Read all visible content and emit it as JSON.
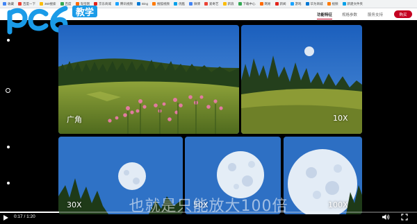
{
  "bookmarks": [
    {
      "label": "收藏"
    },
    {
      "label": "百度一下"
    },
    {
      "label": "360搜索"
    },
    {
      "label": "百度"
    },
    {
      "label": "淘宝网"
    },
    {
      "label": "京东商城"
    },
    {
      "label": "腾讯视频"
    },
    {
      "label": "Bing"
    },
    {
      "label": "搜狐视频"
    },
    {
      "label": "优酷"
    },
    {
      "label": "微博"
    },
    {
      "label": "爱奇艺"
    },
    {
      "label": "新浪"
    },
    {
      "label": "下载中心"
    },
    {
      "label": "网易"
    },
    {
      "label": "新闻"
    },
    {
      "label": "游戏"
    },
    {
      "label": "华为商城"
    },
    {
      "label": "视频"
    },
    {
      "label": "新建文件夹"
    }
  ],
  "site_nav": {
    "features": "功能特征",
    "specs": "规格参数",
    "support": "服务支持",
    "buy": "购买"
  },
  "logo": {
    "badge": "教学"
  },
  "panels": {
    "top_left_label": "广角",
    "top_right_label": "10X",
    "bottom_left_label": "30X",
    "bottom_middle_label": "50X",
    "bottom_right_label": "100X"
  },
  "subtitle": "也就是只能放大100倍",
  "video": {
    "time": "0:17 / 1:20",
    "progress": 0.1417
  },
  "colors": {
    "brand_red": "#c40021",
    "logo_blue": "#1a9be8",
    "sky": "#2f72c6"
  },
  "icons": {
    "play": "play-icon",
    "volume": "volume-icon",
    "fullscreen": "fullscreen-icon"
  }
}
